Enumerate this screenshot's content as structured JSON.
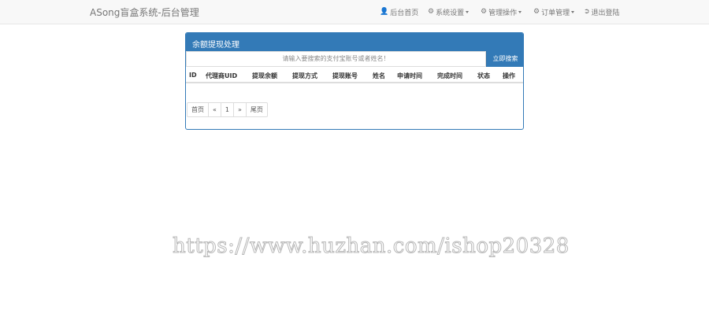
{
  "navbar": {
    "brand": "ASong盲盒系统-后台管理",
    "items": [
      {
        "icon": "user-icon",
        "glyph": "👤",
        "label": "后台首页",
        "caret": false
      },
      {
        "icon": "gear-icon",
        "glyph": "⚙",
        "label": "系统设置",
        "caret": true
      },
      {
        "icon": "gear-icon",
        "glyph": "⚙",
        "label": "管理操作",
        "caret": true
      },
      {
        "icon": "gear-icon",
        "glyph": "⚙",
        "label": "订单管理",
        "caret": true
      },
      {
        "icon": "logout-icon",
        "glyph": "⏏",
        "label": "退出登陆",
        "caret": false
      }
    ]
  },
  "panel": {
    "title": "余额提现处理",
    "search_placeholder": "请输入要搜索的支付宝账号或者姓名！",
    "search_button": "立即搜索",
    "columns": [
      "ID",
      "代理商UID",
      "提现余额",
      "提现方式",
      "提现账号",
      "姓名",
      "申请时间",
      "完成时间",
      "状态",
      "操作"
    ]
  },
  "pagination": [
    "首页",
    "«",
    "1",
    "»",
    "尾页"
  ],
  "watermark": "https://www.huzhan.com/ishop20328",
  "colors": {
    "primary": "#337ab7",
    "navbar_bg": "#f8f8f8"
  }
}
